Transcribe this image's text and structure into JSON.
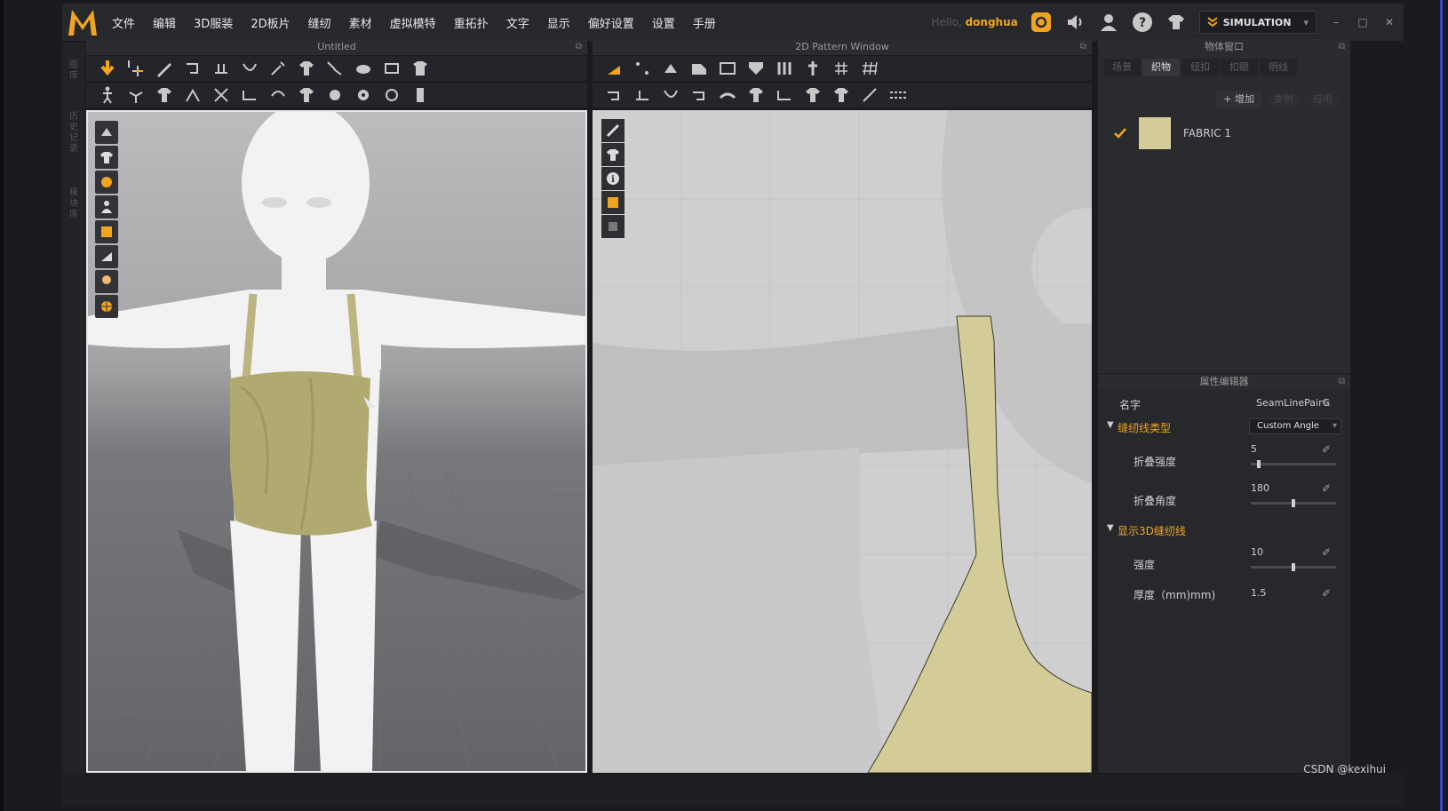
{
  "app": {
    "logo_letter": "M"
  },
  "menu": [
    "文件",
    "编辑",
    "3D服装",
    "2D板片",
    "缝纫",
    "素材",
    "虚拟模特",
    "重拓扑",
    "文字",
    "显示",
    "偏好设置",
    "设置",
    "手册"
  ],
  "header_right": {
    "hello_prefix": "Hello,",
    "username": "donghua",
    "mode_label": "SIMULATION"
  },
  "side_tabs": [
    "图库",
    "历史记录",
    "模块库"
  ],
  "panels": {
    "viewport3d_title": "Untitled",
    "pattern_title": "2D Pattern Window",
    "object_title": "物体窗口",
    "property_title": "属性编辑器"
  },
  "object_window": {
    "tabs": [
      "场景",
      "织物",
      "纽扣",
      "扣眼",
      "明线"
    ],
    "active_tab": "织物",
    "actions": {
      "add": "增加",
      "copy": "复制",
      "apply": "应用"
    },
    "fabrics": [
      {
        "name": "FABRIC 1",
        "color": "#d4cc98"
      }
    ]
  },
  "property_editor": {
    "name_label": "名字",
    "name_value": "SeamLinePairG",
    "seam_type_section": "缝纫线类型",
    "seam_type_value": "Custom Angle",
    "fold_strength_label": "折叠强度",
    "fold_strength_value": "5",
    "fold_strength_fraction": 0.08,
    "fold_angle_label": "折叠角度",
    "fold_angle_value": "180",
    "fold_angle_fraction": 0.5,
    "show3d_section": "显示3D缝纫线",
    "strength_label": "强度",
    "strength_value": "10",
    "strength_fraction": 0.5,
    "thickness_label": "厚度（mm)mm)",
    "thickness_value": "1.5"
  },
  "watermark": "CSDN @kexihui",
  "colors": {
    "accent": "#f0a420",
    "fabric": "#d4cc98",
    "pattern_bg": "#cfcfcf"
  }
}
